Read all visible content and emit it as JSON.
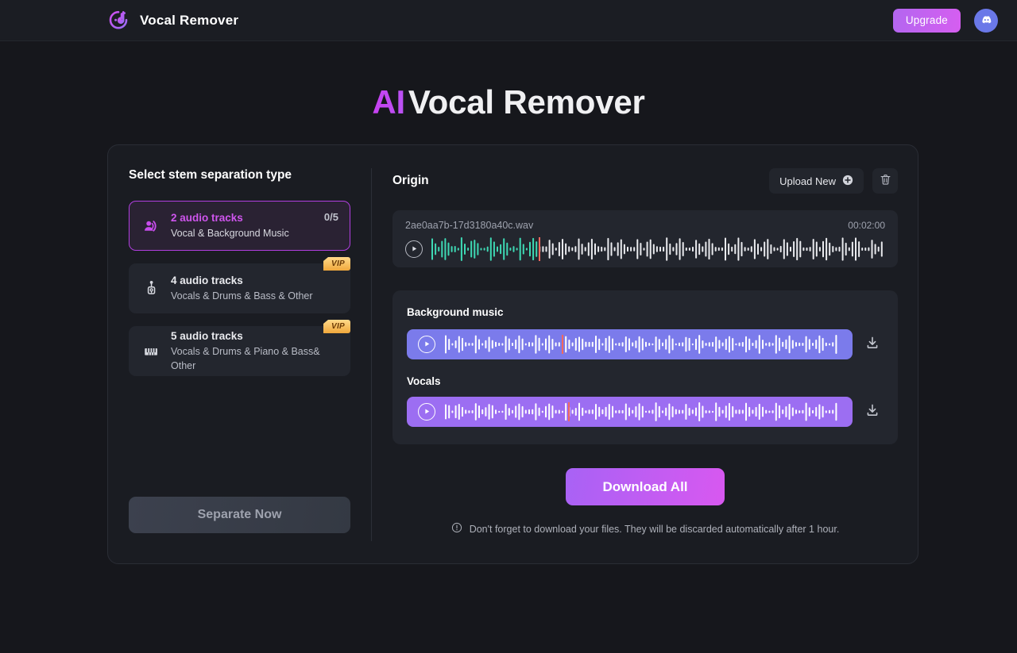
{
  "header": {
    "brand_name": "Vocal Remover",
    "logo_icon": "music-note-logo-icon",
    "upgrade_label": "Upgrade",
    "discord_icon": "discord-icon"
  },
  "hero": {
    "title_accent": "AI",
    "title_rest": "Vocal Remover",
    "accent_color": "#c83ff0"
  },
  "left": {
    "section_title": "Select stem separation type",
    "stems": [
      {
        "title": "2 audio tracks",
        "subtitle": "Vocal & Background Music",
        "count": "0/5",
        "icon": "person-sound-icon",
        "selected": true,
        "vip": false
      },
      {
        "title": "4 audio tracks",
        "subtitle": "Vocals & Drums & Bass & Other",
        "count": "",
        "icon": "microphone-icon",
        "selected": false,
        "vip": true,
        "vip_label": "VIP"
      },
      {
        "title": "5 audio tracks",
        "subtitle": "Vocals & Drums & Piano & Bass& Other",
        "count": "",
        "icon": "piano-icon",
        "selected": false,
        "vip": true,
        "vip_label": "VIP"
      }
    ],
    "separate_label": "Separate Now"
  },
  "right": {
    "origin_title": "Origin",
    "upload_label": "Upload New",
    "upload_icon": "plus-circle-icon",
    "trash_icon": "trash-icon",
    "origin_track": {
      "file_name": "2ae0aa7b-17d3180a40c.wav",
      "duration": "00:02:00",
      "play_icon": "play-icon",
      "progress_pct": 24
    },
    "stems": [
      {
        "label": "Background music",
        "play_icon": "play-icon",
        "download_icon": "download-icon",
        "color": "#7b7beb",
        "progress_pct": 30
      },
      {
        "label": "Vocals",
        "play_icon": "play-icon",
        "download_icon": "download-icon",
        "color": "#9c6ef2",
        "progress_pct": 31
      }
    ],
    "download_all_label": "Download All",
    "notice_icon": "info-icon",
    "notice_text": "Don't forget to download your files. They will be discarded automatically after 1 hour."
  }
}
